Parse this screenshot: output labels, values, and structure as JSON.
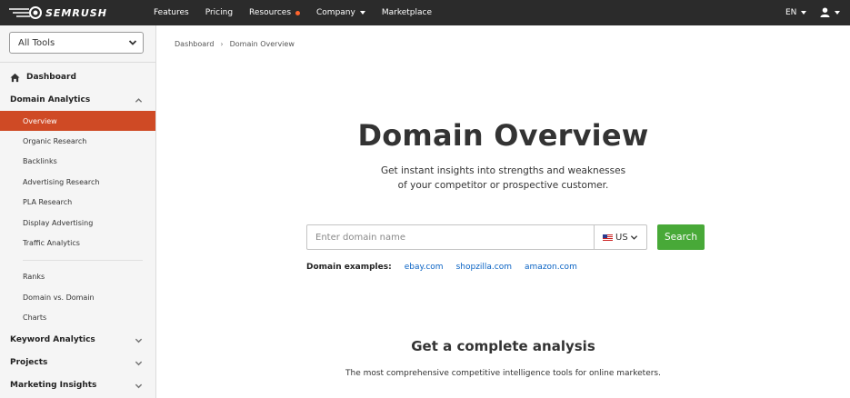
{
  "topbar": {
    "logo_text": "SEMRUSH",
    "nav": [
      {
        "label": "Features"
      },
      {
        "label": "Pricing"
      },
      {
        "label": "Resources"
      },
      {
        "label": "Company"
      },
      {
        "label": "Marketplace"
      }
    ],
    "language": "EN",
    "colors": {
      "background": "#2b2b2b",
      "accent_dot": "#ff642d"
    }
  },
  "sidebar": {
    "tools_select": "All Tools",
    "dashboard": "Dashboard",
    "domain_analytics": {
      "label": "Domain Analytics",
      "items": [
        "Overview",
        "Organic Research",
        "Backlinks",
        "Advertising Research",
        "PLA Research",
        "Display Advertising",
        "Traffic Analytics"
      ],
      "items2": [
        "Ranks",
        "Domain vs. Domain",
        "Charts"
      ]
    },
    "sections": [
      "Keyword Analytics",
      "Projects",
      "Marketing Insights"
    ],
    "active_color": "#cf4a25"
  },
  "breadcrumb": [
    "Dashboard",
    "Domain Overview"
  ],
  "main": {
    "title": "Domain Overview",
    "subtitle_line1": "Get instant insights into strengths and weaknesses",
    "subtitle_line2": "of your competitor or prospective customer.",
    "search_placeholder": "Enter domain name",
    "country": "US",
    "search_button": "Search",
    "examples_label": "Domain examples:",
    "examples": [
      "ebay.com",
      "shopzilla.com",
      "amazon.com"
    ],
    "section_title": "Get a complete analysis",
    "section_sub": "The most comprehensive competitive intelligence tools for online marketers.",
    "button_color": "#48a938",
    "link_color": "#0a63c4"
  }
}
